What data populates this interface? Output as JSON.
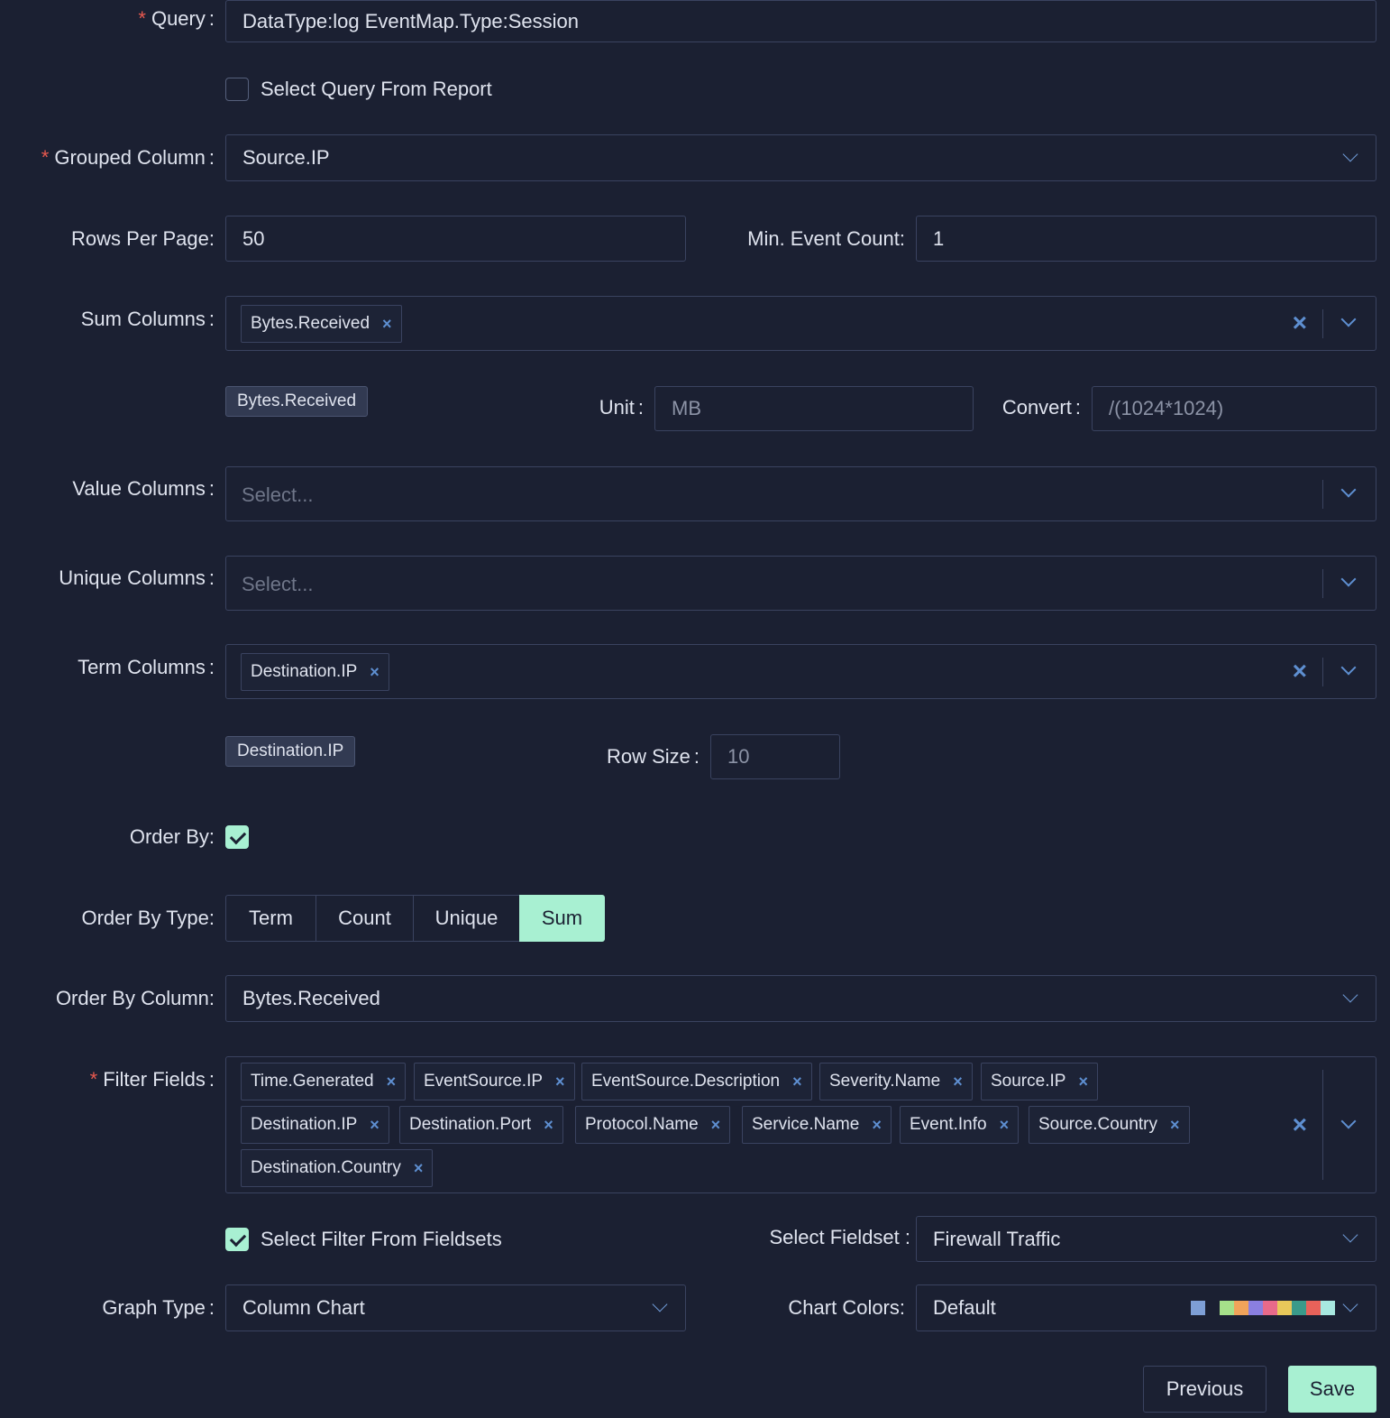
{
  "query": {
    "label": "Query",
    "value": "DataType:log EventMap.Type:Session"
  },
  "select_query_from_report": {
    "label": "Select Query From Report",
    "checked": false
  },
  "grouped_column": {
    "label": "Grouped Column",
    "value": "Source.IP"
  },
  "rows_per_page": {
    "label": "Rows Per Page:",
    "value": "50"
  },
  "min_event_count": {
    "label": "Min. Event Count:",
    "value": "1"
  },
  "sum_columns": {
    "label": "Sum Columns",
    "tags": [
      "Bytes.Received"
    ]
  },
  "sum_detail": {
    "chip": "Bytes.Received",
    "unit_label": "Unit",
    "unit_value": "MB",
    "convert_label": "Convert",
    "convert_value": "/(1024*1024)"
  },
  "value_columns": {
    "label": "Value Columns",
    "placeholder": "Select..."
  },
  "unique_columns": {
    "label": "Unique Columns",
    "placeholder": "Select..."
  },
  "term_columns": {
    "label": "Term Columns",
    "tags": [
      "Destination.IP"
    ]
  },
  "term_detail": {
    "chip": "Destination.IP",
    "row_size_label": "Row Size",
    "row_size_value": "10"
  },
  "order_by": {
    "label": "Order By:",
    "checked": true
  },
  "order_by_type": {
    "label": "Order By Type:",
    "options": [
      "Term",
      "Count",
      "Unique",
      "Sum"
    ],
    "selected": "Sum"
  },
  "order_by_column": {
    "label": "Order By Column:",
    "value": "Bytes.Received"
  },
  "filter_fields": {
    "label": "Filter Fields",
    "tags": [
      "Time.Generated",
      "EventSource.IP",
      "EventSource.Description",
      "Severity.Name",
      "Source.IP",
      "Destination.IP",
      "Destination.Port",
      "Protocol.Name",
      "Service.Name",
      "Event.Info",
      "Source.Country",
      "Destination.Country"
    ]
  },
  "select_filter_from_fieldsets": {
    "label": "Select Filter From Fieldsets",
    "checked": true
  },
  "select_fieldset": {
    "label": "Select Fieldset :",
    "value": "Firewall Traffic"
  },
  "graph_type": {
    "label": "Graph Type",
    "value": "Column Chart"
  },
  "chart_colors": {
    "label": "Chart Colors:",
    "value": "Default",
    "swatches": [
      "#7e9fd6",
      "#1b2032",
      "#a6e08a",
      "#f0a35a",
      "#8a7fe0",
      "#e86a8a",
      "#e8c85a",
      "#3a9a8a",
      "#e8625a",
      "#a8e8e0"
    ]
  },
  "buttons": {
    "previous": "Previous",
    "save": "Save"
  },
  "colors": {
    "background": "#1b2032",
    "accent": "#a8f0d2",
    "icon": "#5e8fd1",
    "required": "#e8594f"
  }
}
